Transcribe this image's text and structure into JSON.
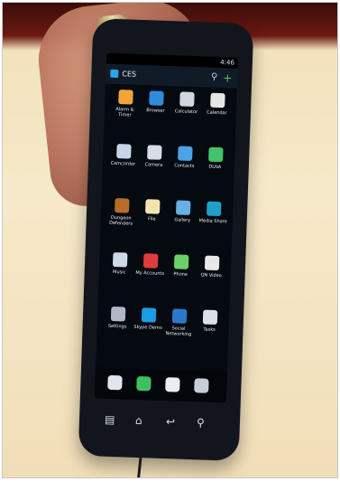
{
  "status_bar": {
    "left": "",
    "right": "4:46"
  },
  "action_bar": {
    "title": "CES"
  },
  "apps": [
    {
      "label": "Alarm & Timer",
      "icon": "alarm-icon",
      "color": "#f3a23a"
    },
    {
      "label": "Browser",
      "icon": "globe-icon",
      "color": "#2f8bd8"
    },
    {
      "label": "Calculator",
      "icon": "calculator-icon",
      "color": "#cfd6df"
    },
    {
      "label": "Calendar",
      "icon": "calendar-icon",
      "color": "#e6e6e6"
    },
    {
      "label": "Camcorder",
      "icon": "camcorder-icon",
      "color": "#c7d6e6"
    },
    {
      "label": "Camera",
      "icon": "camera-icon",
      "color": "#d7dde6"
    },
    {
      "label": "Contacts",
      "icon": "contacts-icon",
      "color": "#4aa3e6"
    },
    {
      "label": "DLNA",
      "icon": "dlna-icon",
      "color": "#43c46a"
    },
    {
      "label": "Dungeon Defenders",
      "icon": "game-icon",
      "color": "#b86b2b"
    },
    {
      "label": "File",
      "icon": "file-icon",
      "color": "#f3e3b0"
    },
    {
      "label": "Gallery",
      "icon": "gallery-icon",
      "color": "#66b0e6"
    },
    {
      "label": "Media Share",
      "icon": "media-share-icon",
      "color": "#1ea0c8"
    },
    {
      "label": "Music",
      "icon": "music-icon",
      "color": "#d0d7e6"
    },
    {
      "label": "My Accounts",
      "icon": "accounts-icon",
      "color": "#e23b3b"
    },
    {
      "label": "Phone",
      "icon": "phone-icon",
      "color": "#6ad06a"
    },
    {
      "label": "QN Video",
      "icon": "video-icon",
      "color": "#e8e8e8"
    },
    {
      "label": "Settings",
      "icon": "gear-icon",
      "color": "#b0b8c6"
    },
    {
      "label": "Skype Demo",
      "icon": "skype-icon",
      "color": "#1e9be6"
    },
    {
      "label": "Social Networking",
      "icon": "social-icon",
      "color": "#2b78c8"
    },
    {
      "label": "Tasks",
      "icon": "tasks-icon",
      "color": "#d9e0ea"
    }
  ],
  "dock": [
    {
      "icon": "messaging-icon",
      "color": "#dfe6ef"
    },
    {
      "icon": "market-icon",
      "color": "#3fbf5f"
    },
    {
      "icon": "email-icon",
      "color": "#e9eef4"
    },
    {
      "icon": "apps-icon",
      "color": "#c8ced8"
    }
  ],
  "nav_buttons": [
    {
      "icon": "menu-icon",
      "glyph": "▤"
    },
    {
      "icon": "home-icon",
      "glyph": "⌂"
    },
    {
      "icon": "back-icon",
      "glyph": "↩"
    },
    {
      "icon": "search-icon",
      "glyph": "⚲"
    }
  ]
}
